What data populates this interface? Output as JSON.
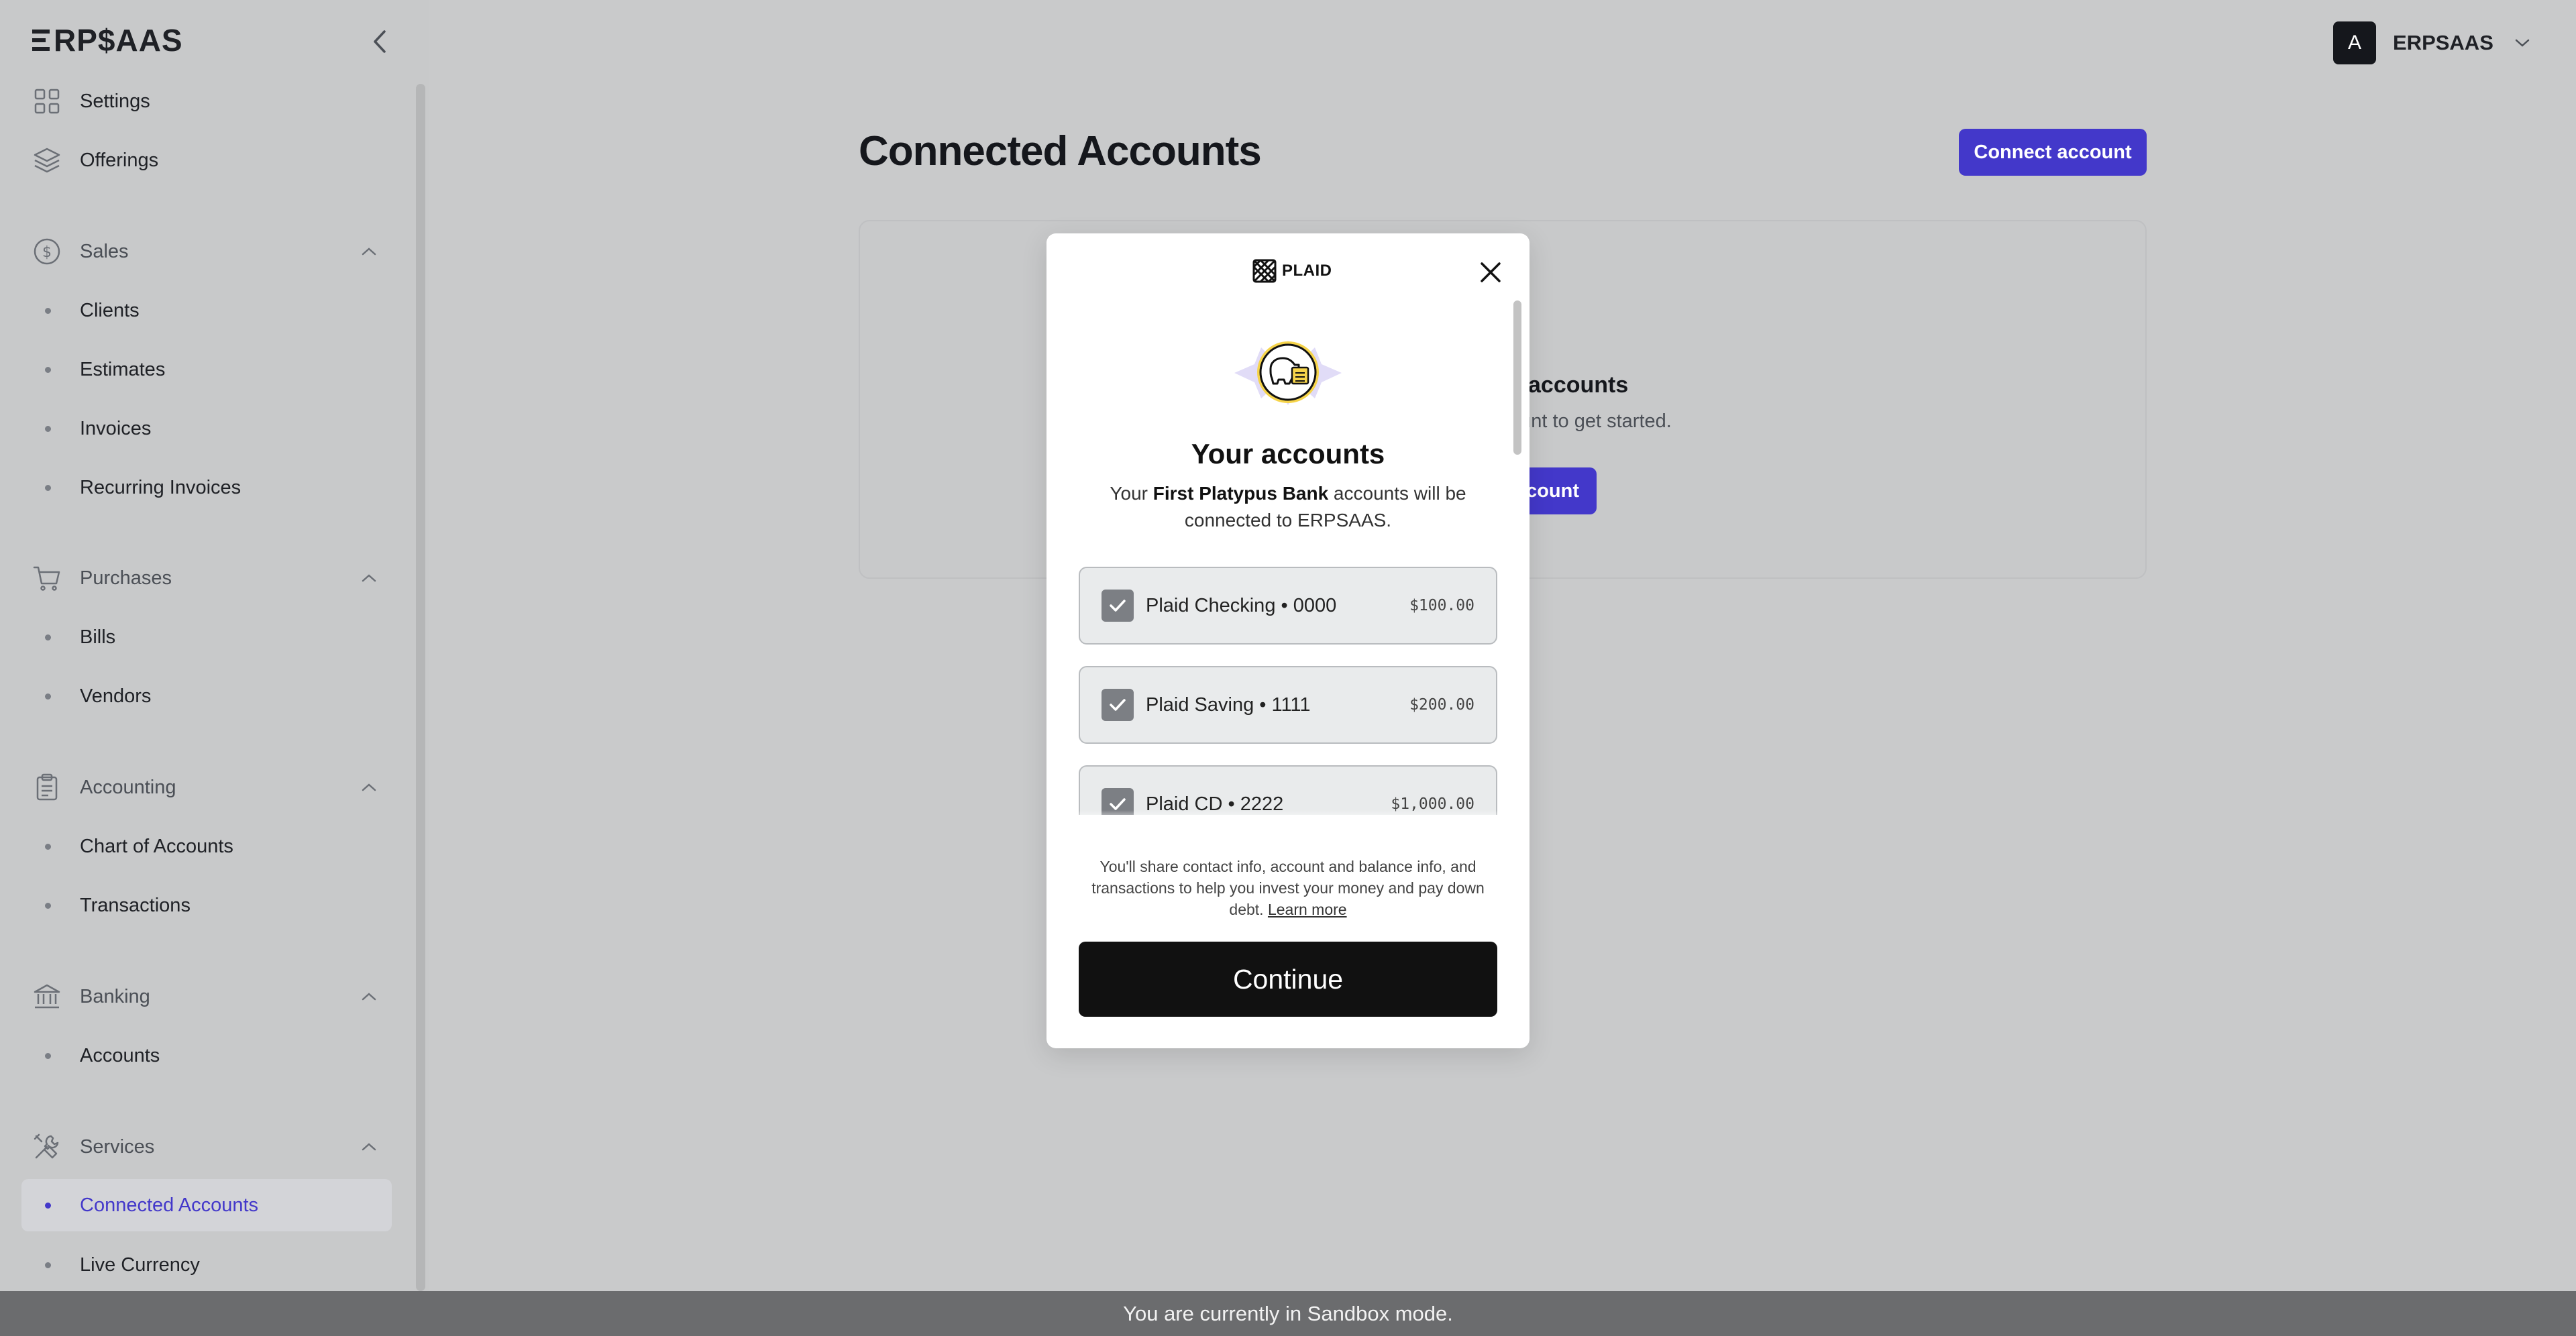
{
  "app": {
    "logo_text": "RP$AAS",
    "collapse_label": ""
  },
  "sidebar": {
    "top_items": [
      {
        "label": "Settings",
        "icon": "grid-icon"
      },
      {
        "label": "Offerings",
        "icon": "layers-icon"
      }
    ],
    "sections": [
      {
        "label": "Sales",
        "icon": "dollar-circle-icon",
        "items": [
          "Clients",
          "Estimates",
          "Invoices",
          "Recurring Invoices"
        ]
      },
      {
        "label": "Purchases",
        "icon": "cart-icon",
        "items": [
          "Bills",
          "Vendors"
        ]
      },
      {
        "label": "Accounting",
        "icon": "clipboard-icon",
        "items": [
          "Chart of Accounts",
          "Transactions"
        ]
      },
      {
        "label": "Banking",
        "icon": "bank-icon",
        "items": [
          "Accounts"
        ]
      },
      {
        "label": "Services",
        "icon": "tools-icon",
        "items": [
          "Connected Accounts",
          "Live Currency"
        ]
      }
    ],
    "active_item": "Connected Accounts"
  },
  "user": {
    "avatar_initial": "A",
    "name": "ERPSAAS"
  },
  "main": {
    "title": "Connected Accounts",
    "connect_button": "Connect account",
    "empty_title": "accounts",
    "empty_subtitle": "ount to get started.",
    "empty_button": "count"
  },
  "modal": {
    "brand": "PLAID",
    "title": "Your accounts",
    "desc_prefix": "Your ",
    "bank_name": "First Platypus Bank",
    "desc_suffix": " accounts will be connected to ERPSAAS.",
    "accounts": [
      {
        "name": "Plaid Checking • 0000",
        "balance": "$100.00",
        "checked": true
      },
      {
        "name": "Plaid Saving • 1111",
        "balance": "$200.00",
        "checked": true
      },
      {
        "name": "Plaid CD • 2222",
        "balance": "$1,000.00",
        "checked": true
      }
    ],
    "disclaimer": "You'll share contact info, account and balance info, and transactions to help you invest your money and pay down debt.",
    "learn_more": "Learn more",
    "continue_label": "Continue"
  },
  "footer": {
    "sandbox_text": "You are currently in Sandbox mode."
  },
  "colors": {
    "accent": "#4338ca",
    "overlay_bg": "#c9cacb",
    "footer_bg": "#6b6c6e",
    "continue_bg": "#111111"
  }
}
